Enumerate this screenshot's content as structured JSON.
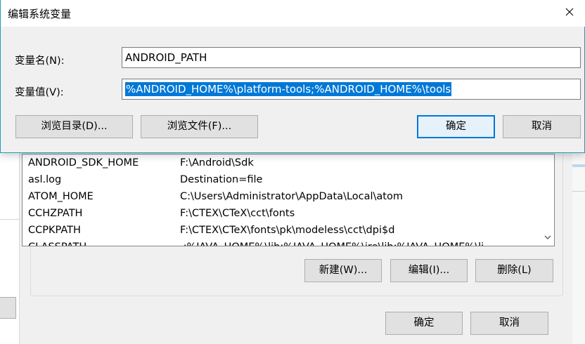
{
  "dialog": {
    "title": "编辑系统变量",
    "name_label": "变量名(N):",
    "name_value": "ANDROID_PATH",
    "value_label": "变量值(V):",
    "value_value": "%ANDROID_HOME%\\platform-tools;%ANDROID_HOME%\\tools",
    "browse_dir_label": "浏览目录(D)...",
    "browse_file_label": "浏览文件(F)...",
    "ok_label": "确定",
    "cancel_label": "取消",
    "close_icon": "close-icon"
  },
  "system_vars": {
    "rows": [
      {
        "name": "ANDROID_SDK_HOME",
        "value": "F:\\Android\\Sdk"
      },
      {
        "name": "asl.log",
        "value": "Destination=file"
      },
      {
        "name": "ATOM_HOME",
        "value": "C:\\Users\\Administrator\\AppData\\Local\\atom"
      },
      {
        "name": "CCHZPATH",
        "value": "F:\\CTEX\\CTeX\\cct\\fonts"
      },
      {
        "name": "CCPKPATH",
        "value": "F:\\CTEX\\CTeX\\fonts\\pk\\modeless\\cct\\dpi$d"
      },
      {
        "name": "CLASSPATH",
        "value": ".;%JAVA_HOME%\\lib;%JAVA_HOME%\\jre\\lib;%JAVA_HOME%\\li"
      }
    ],
    "new_label": "新建(W)...",
    "edit_label": "编辑(I)...",
    "delete_label": "删除(L)"
  },
  "main_buttons": {
    "ok_label": "确定",
    "cancel_label": "取消"
  },
  "colors": {
    "accent": "#0078d7",
    "dialog_border": "#1a9fb5"
  }
}
